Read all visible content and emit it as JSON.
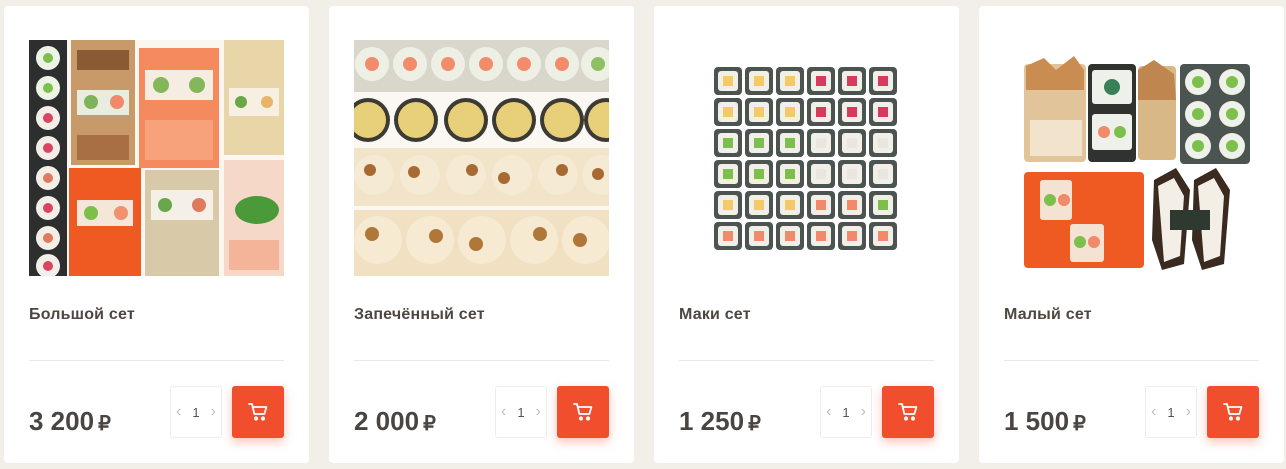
{
  "products": [
    {
      "name": "Большой сет",
      "price": "3 200",
      "currency": "₽",
      "qty": "1",
      "qty_prev": "‹",
      "qty_next": "›"
    },
    {
      "name": "Запечённый сет",
      "price": "2 000",
      "currency": "₽",
      "qty": "1",
      "qty_prev": "‹",
      "qty_next": "›"
    },
    {
      "name": "Маки сет",
      "price": "1 250",
      "currency": "₽",
      "qty": "1",
      "qty_prev": "‹",
      "qty_next": "›"
    },
    {
      "name": "Малый сет",
      "price": "1 500",
      "currency": "₽",
      "qty": "1",
      "qty_prev": "‹",
      "qty_next": "›"
    }
  ],
  "colors": {
    "accent": "#f04e2d",
    "background": "#f2efe9",
    "card": "#ffffff",
    "text": "#4a4540"
  },
  "icons": {
    "cart_button": "cart-icon",
    "qty_prev": "chevron-left-icon",
    "qty_next": "chevron-right-icon"
  }
}
